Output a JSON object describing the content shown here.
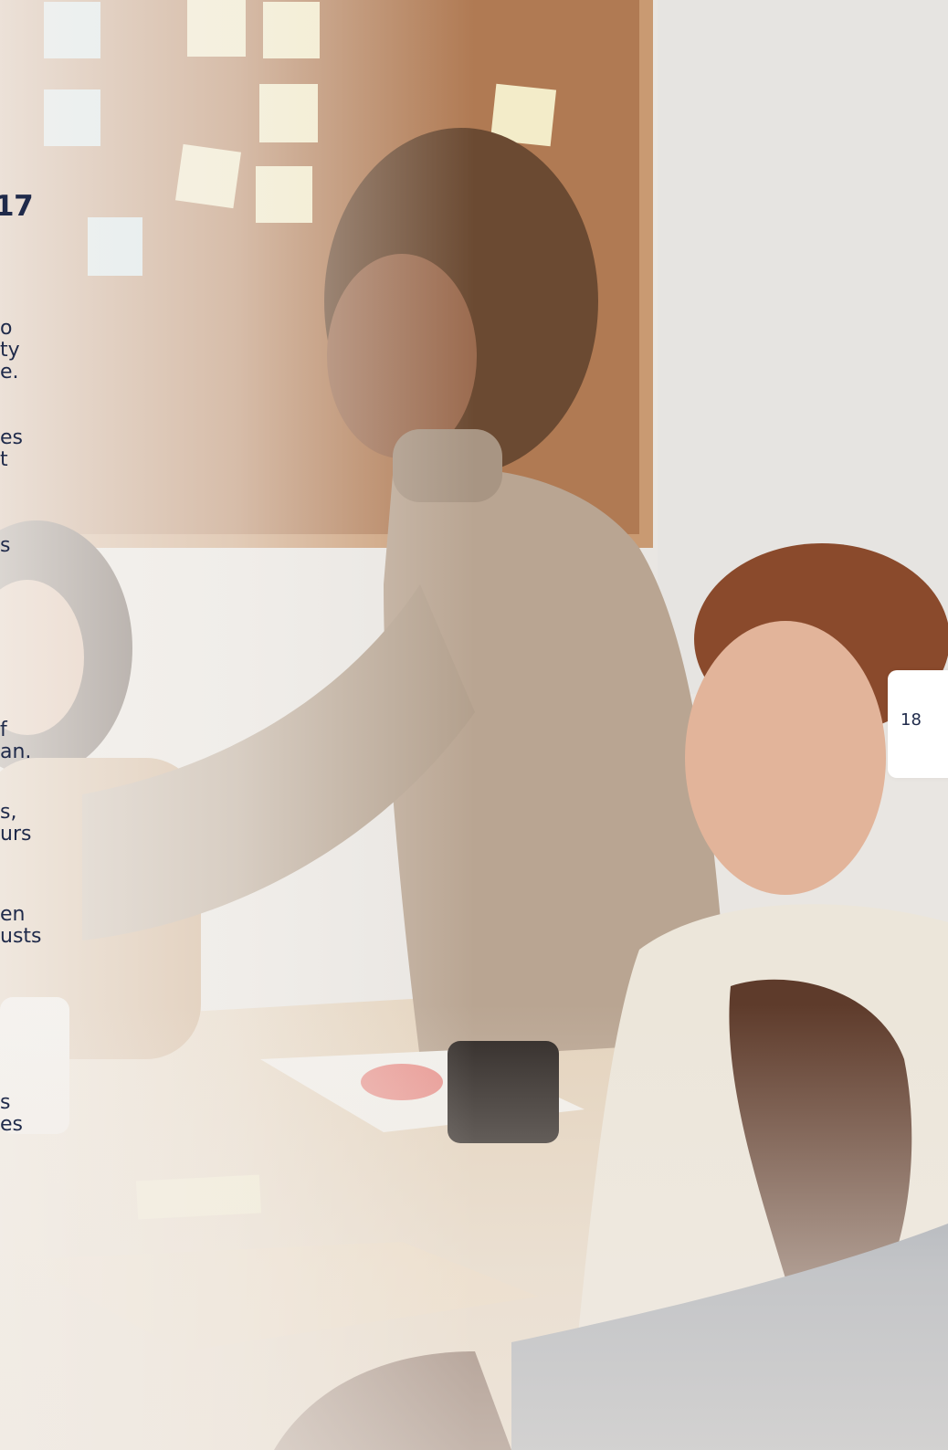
{
  "document": {
    "heading_fragment": "17",
    "page_number": "18",
    "text_fragments": [
      "o",
      "ty",
      "e.",
      "es",
      "t",
      "s",
      "f",
      "an.",
      "s,",
      "urs",
      "en",
      "usts",
      "s",
      "es"
    ]
  },
  "colors": {
    "text": "#1f2a4a",
    "tab_background": "#ffffff",
    "corkboard": "#b07a53",
    "wall": "#e9e6e2",
    "table": "#e4d3bd",
    "sticky_yellow": "#f3ecc9",
    "sticky_blue": "#cfe6ef"
  },
  "photo": {
    "subject_icon": "meeting-photo-icon"
  }
}
